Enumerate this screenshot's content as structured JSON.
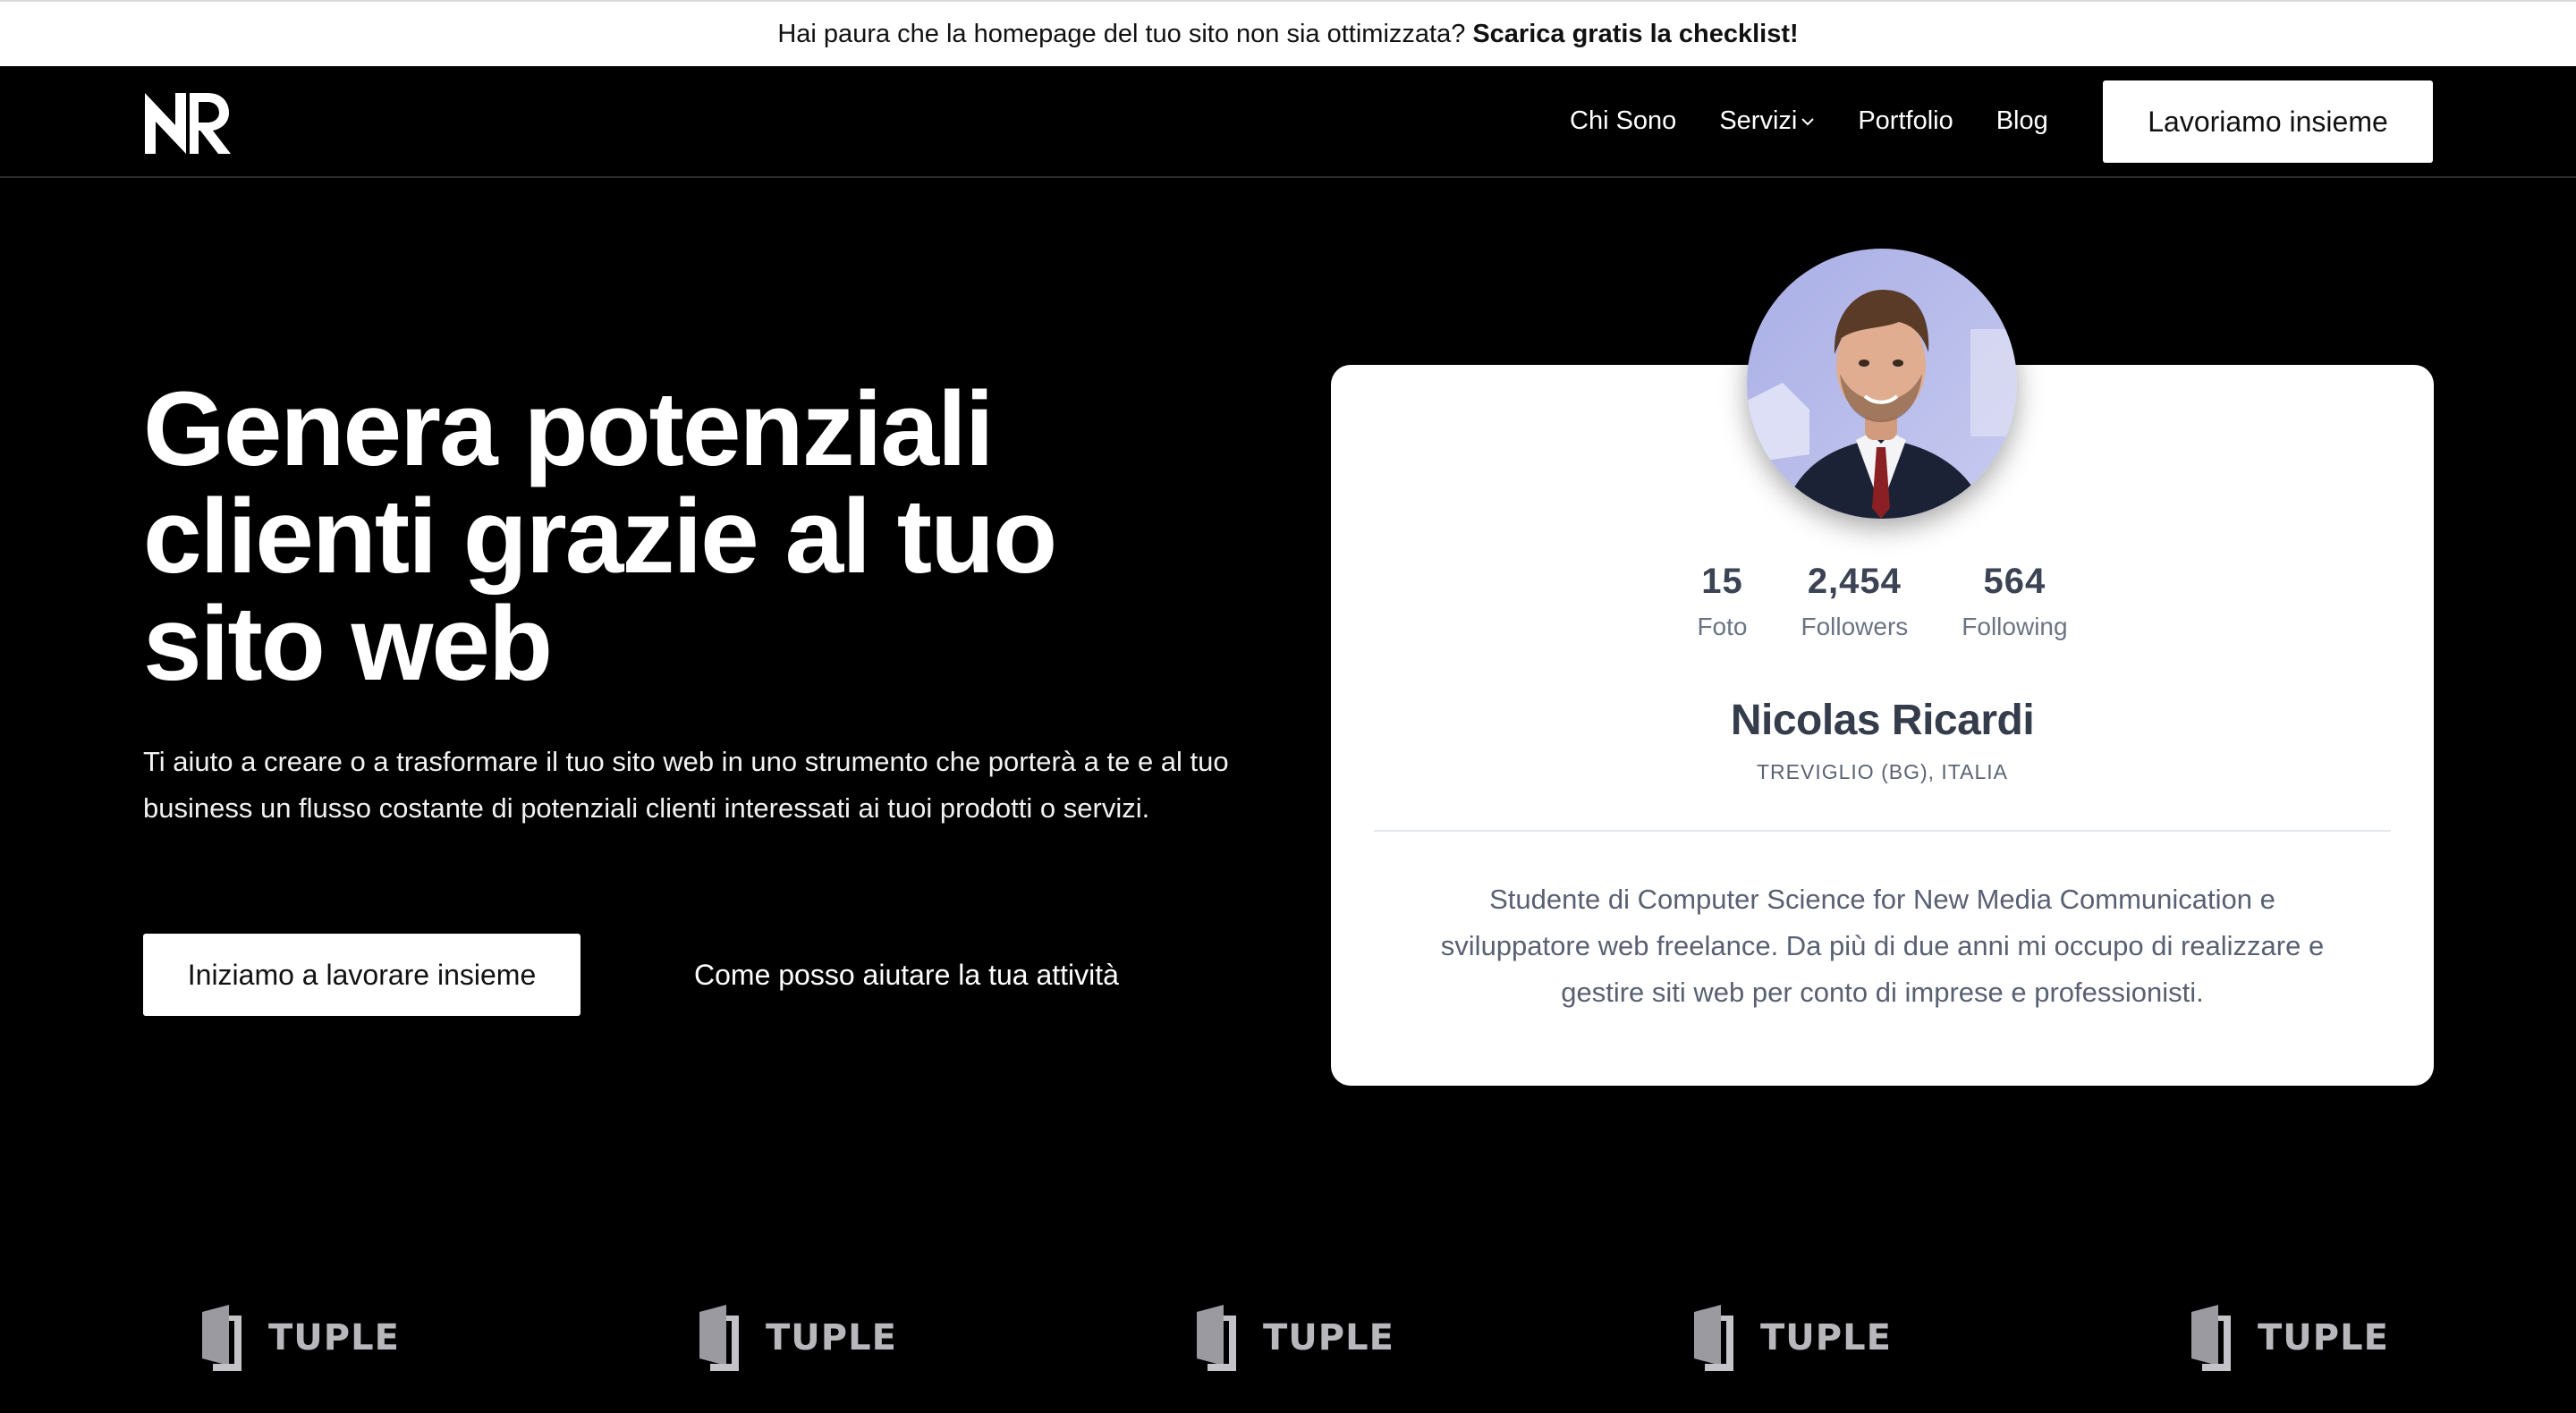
{
  "announcement": {
    "text": "Hai paura che la homepage del tuo sito non sia ottimizzata?",
    "link_label": "Scarica gratis la checklist!"
  },
  "header": {
    "nav": [
      {
        "label": "Chi Sono"
      },
      {
        "label": "Servizi"
      },
      {
        "label": "Portfolio"
      },
      {
        "label": "Blog"
      }
    ],
    "cta_label": "Lavoriamo insieme"
  },
  "hero": {
    "title": "Genera potenziali clienti grazie al tuo sito web",
    "description": "Ti aiuto a creare o a trasformare il tuo sito web in uno strumento che porterà a te e al tuo business un flusso costante di potenziali clienti interessati ai tuoi prodotti o servizi.",
    "primary_button": "Iniziamo a lavorare insieme",
    "secondary_link": "Come posso aiutare la tua attività"
  },
  "profile": {
    "stats": [
      {
        "value": "15",
        "label": "Foto"
      },
      {
        "value": "2,454",
        "label": "Followers"
      },
      {
        "value": "564",
        "label": "Following"
      }
    ],
    "name": "Nicolas Ricardi",
    "location": "TREVIGLIO (BG), ITALIA",
    "bio": "Studente di Computer Science for New Media Communication e sviluppatore web freelance. Da più di due anni mi occupo di realizzare e gestire siti web per conto di imprese e professionisti."
  },
  "logos": [
    {
      "name": "TUPLE"
    },
    {
      "name": "TUPLE"
    },
    {
      "name": "TUPLE"
    },
    {
      "name": "TUPLE"
    },
    {
      "name": "TUPLE"
    }
  ],
  "colors": {
    "background": "#000000",
    "card": "#ffffff",
    "heading_dark": "#353d4c",
    "muted_text": "#586072",
    "logo_gray": "#b8b8bc"
  },
  "icons": {
    "brand_logo": "nr-monogram-logo",
    "dropdown": "chevron-down-icon",
    "logo_mark": "tuple-door-icon"
  }
}
